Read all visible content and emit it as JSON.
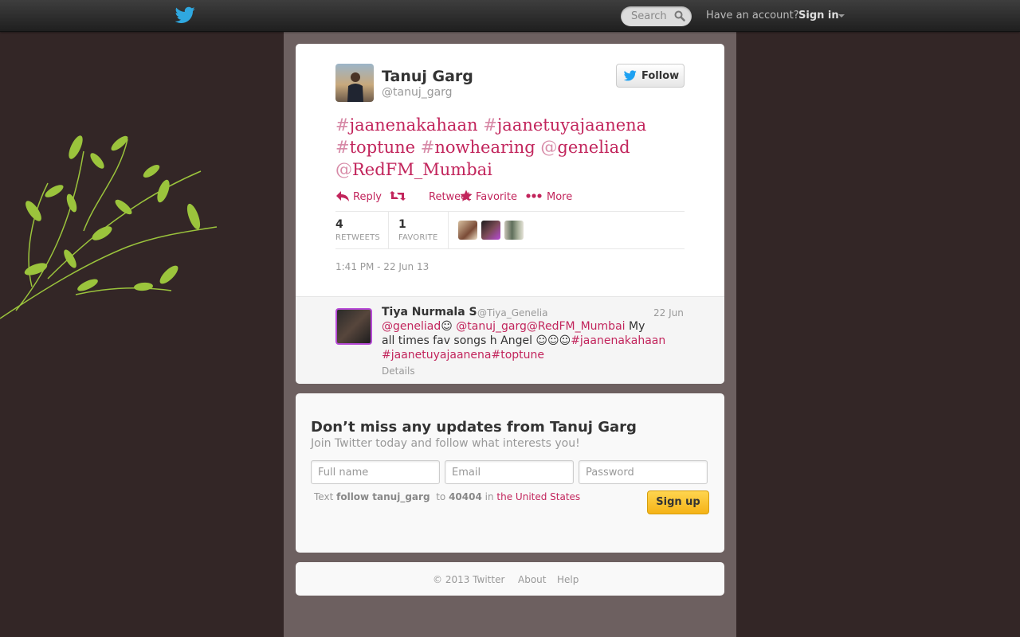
{
  "topbar": {
    "search_placeholder": "Search",
    "have_account": "Have an account?",
    "sign_in": "Sign in"
  },
  "tweet": {
    "author_name": "Tanuj Garg",
    "author_handle": "@tanuj_garg",
    "follow_label": "Follow",
    "text_parts": [
      {
        "hash": "#",
        "word": "jaanenakahaan"
      },
      {
        "hash": "#",
        "word": "jaanetuyajaanena"
      },
      {
        "hash": "#",
        "word": "toptune"
      },
      {
        "hash": "#",
        "word": "nowhearing"
      },
      {
        "hash": "@",
        "word": "geneliad"
      },
      {
        "hash": "@",
        "word": "RedFM_Mumbai"
      }
    ],
    "actions": {
      "reply": "Reply",
      "retweet": "Retweet",
      "favorite": "Favorite",
      "more": "More"
    },
    "stats": {
      "retweets_count": "4",
      "retweets_label": "RETWEETS",
      "favorites_count": "1",
      "favorites_label": "FAVORITE"
    },
    "timestamp": "1:41 PM - 22 Jun 13"
  },
  "reply": {
    "name": "Tiya Nurmala S",
    "handle": "@Tiya_Genelia",
    "date": "22 Jun",
    "body": {
      "l1_a": "@geneliad",
      "l1_b": "☺ ",
      "l1_c": "@tanuj_garg",
      "l1_d": "@RedFM_Mumbai",
      "l1_e": " My",
      "l2_a": "all times fav songs h Angel ☺☺☺",
      "l2_b": "#jaanenakahaan",
      "l3_a": "#jaanetuyajaanena",
      "l3_b": "#toptune"
    },
    "details": "Details"
  },
  "signup": {
    "heading": "Don’t miss any updates from Tanuj Garg",
    "subheading": "Join Twitter today and follow what interests you!",
    "fullname_placeholder": "Full name",
    "email_placeholder": "Email",
    "password_placeholder": "Password",
    "sms_text": "Text",
    "sms_command": "follow tanuj_garg",
    "sms_to": "to",
    "sms_number": "40404",
    "sms_in": "in",
    "sms_country": "the United States",
    "button": "Sign up"
  },
  "footer": {
    "copyright": "© 2013 Twitter",
    "about": "About",
    "help": "Help"
  },
  "colors": {
    "link": "#c2255c",
    "background": "#332626",
    "column": "#6d6060",
    "twitter_blue": "#1da1f2"
  }
}
